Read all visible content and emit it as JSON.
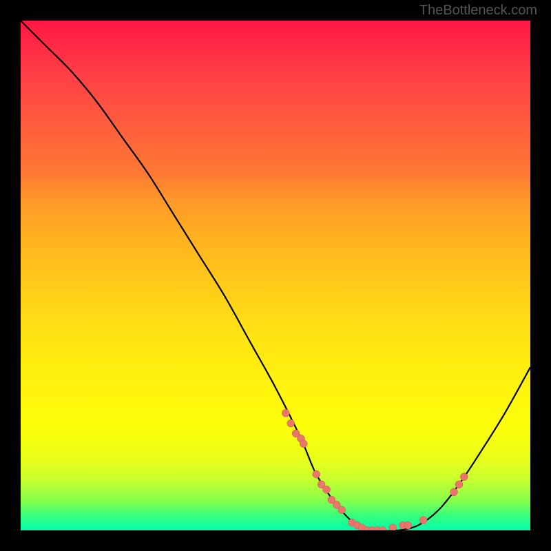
{
  "watermark": "TheBottleneck.com",
  "chart_data": {
    "type": "line",
    "title": "",
    "xlabel": "",
    "ylabel": "",
    "xlim": [
      0,
      100
    ],
    "ylim": [
      0,
      100
    ],
    "series": [
      {
        "name": "bottleneck-curve",
        "x": [
          0,
          5,
          10,
          15,
          20,
          25,
          30,
          35,
          40,
          45,
          50,
          55,
          58,
          62,
          66,
          70,
          74,
          78,
          82,
          86,
          90,
          95,
          100
        ],
        "y": [
          100,
          95,
          90,
          84,
          77,
          70,
          62,
          54,
          46,
          37,
          28,
          18,
          11,
          5,
          1,
          0,
          0,
          1,
          4,
          9,
          15,
          23,
          32
        ]
      }
    ],
    "scatter_points": {
      "name": "highlight-dots",
      "x": [
        52,
        53,
        54,
        55,
        55.5,
        58,
        59,
        60,
        61,
        62,
        63,
        65,
        66,
        67,
        68,
        69,
        70,
        71,
        73,
        75,
        76,
        79,
        85,
        86,
        87
      ],
      "y": [
        23,
        21,
        19,
        18,
        17,
        11,
        9,
        8,
        6,
        5,
        4,
        1.5,
        1,
        0.5,
        0,
        0,
        0,
        0,
        0.5,
        1,
        1,
        2,
        7.5,
        9,
        10.5
      ]
    },
    "gradient": {
      "orientation": "vertical",
      "stops": [
        {
          "pos": 0,
          "color": "#ff1744"
        },
        {
          "pos": 50,
          "color": "#ffc61a"
        },
        {
          "pos": 80,
          "color": "#fdff0a"
        },
        {
          "pos": 100,
          "color": "#00ffae"
        }
      ]
    },
    "grid": false,
    "legend": false
  }
}
